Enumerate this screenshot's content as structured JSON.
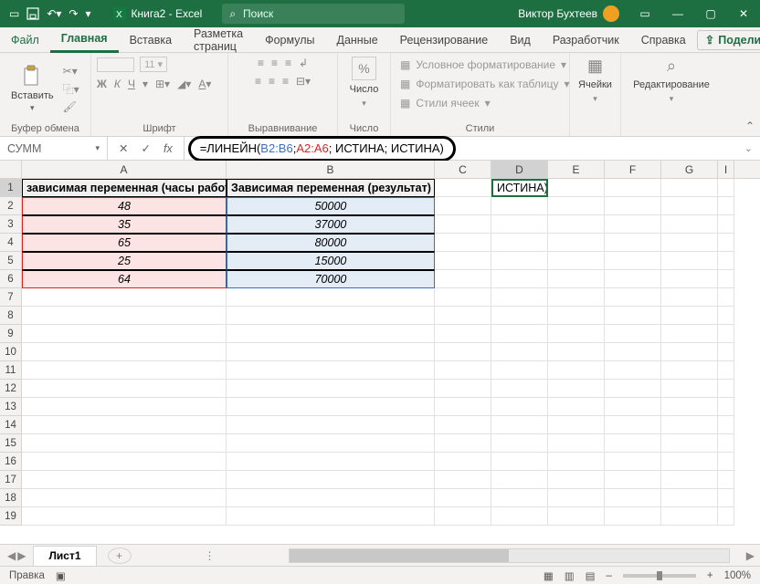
{
  "titlebar": {
    "title": "Книга2 - Excel",
    "search_placeholder": "Поиск",
    "user_name": "Виктор Бухтеев"
  },
  "tabs": {
    "file": "Файл",
    "home": "Главная",
    "insert": "Вставка",
    "layout": "Разметка страниц",
    "formulas": "Формулы",
    "data": "Данные",
    "review": "Рецензирование",
    "view": "Вид",
    "developer": "Разработчик",
    "help": "Справка",
    "share": "Поделиться"
  },
  "ribbon": {
    "paste": "Вставить",
    "clipboard": "Буфер обмена",
    "font": "Шрифт",
    "alignment": "Выравнивание",
    "number_btn": "Число",
    "number": "Число",
    "cond_fmt": "Условное форматирование",
    "as_table": "Форматировать как таблицу",
    "cell_styles": "Стили ячеек",
    "styles": "Стили",
    "cells": "Ячейки",
    "editing": "Редактирование"
  },
  "namebox": "СУММ",
  "formula": {
    "func": "=ЛИНЕЙН(",
    "arg1": "B2:B6",
    "sep": "; ",
    "arg2": "A2:A6",
    "rest": "; ИСТИНА; ИСТИНА)"
  },
  "columns": [
    "A",
    "B",
    "C",
    "D",
    "E",
    "F",
    "G",
    "I"
  ],
  "headerA": "зависимая переменная (часы работы)",
  "headerB": "Зависимая переменная (результат)",
  "cell_d1": "ИСТИНА)",
  "dataA": [
    "48",
    "35",
    "65",
    "25",
    "64"
  ],
  "dataB": [
    "50000",
    "37000",
    "80000",
    "15000",
    "70000"
  ],
  "fx_label": "fx",
  "sheet": "Лист1",
  "status": {
    "mode": "Правка",
    "zoom": "100%"
  }
}
